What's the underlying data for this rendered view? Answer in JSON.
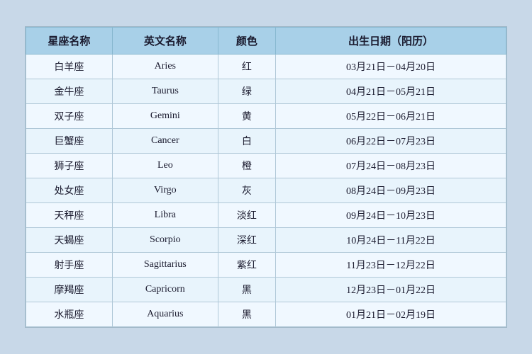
{
  "table": {
    "headers": {
      "chinese_name": "星座名称",
      "english_name": "英文名称",
      "color": "颜色",
      "birth_date": "出生日期（阳历）"
    },
    "rows": [
      {
        "chinese": "白羊座",
        "english": "Aries",
        "color": "红",
        "date": "03月21日－04月20日"
      },
      {
        "chinese": "金牛座",
        "english": "Taurus",
        "color": "绿",
        "date": "04月21日－05月21日"
      },
      {
        "chinese": "双子座",
        "english": "Gemini",
        "color": "黄",
        "date": "05月22日－06月21日"
      },
      {
        "chinese": "巨蟹座",
        "english": "Cancer",
        "color": "白",
        "date": "06月22日－07月23日"
      },
      {
        "chinese": "狮子座",
        "english": "Leo",
        "color": "橙",
        "date": "07月24日－08月23日"
      },
      {
        "chinese": "处女座",
        "english": "Virgo",
        "color": "灰",
        "date": "08月24日－09月23日"
      },
      {
        "chinese": "天秤座",
        "english": "Libra",
        "color": "淡红",
        "date": "09月24日－10月23日"
      },
      {
        "chinese": "天蝎座",
        "english": "Scorpio",
        "color": "深红",
        "date": "10月24日－11月22日"
      },
      {
        "chinese": "射手座",
        "english": "Sagittarius",
        "color": "紫红",
        "date": "11月23日－12月22日"
      },
      {
        "chinese": "摩羯座",
        "english": "Capricorn",
        "color": "黑",
        "date": "12月23日－01月22日"
      },
      {
        "chinese": "水瓶座",
        "english": "Aquarius",
        "color": "黑",
        "date": "01月21日－02月19日"
      }
    ]
  }
}
